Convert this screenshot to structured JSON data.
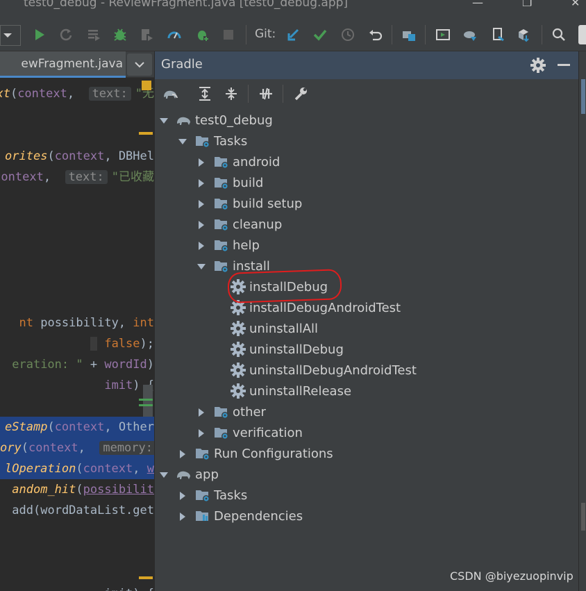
{
  "window": {
    "title": "test0_debug - ReviewFragment.java [test0_debug.app]",
    "minimize": "—",
    "maximize": "❐",
    "close": "✕"
  },
  "toolbar": {
    "git_label": "Git:",
    "icons": [
      "config-dropdown",
      "run-icon",
      "rerun-icon",
      "run-coverage-icon",
      "debug-icon",
      "profile-icon",
      "profiler-icon",
      "attach-debugger-icon",
      "stop-icon",
      "git-update-icon",
      "git-commit-icon",
      "git-history-icon",
      "git-rollback-icon",
      "project-structure-icon",
      "emulator-icon",
      "gradle-sync-icon",
      "device-manager-icon",
      "sdk-manager-icon",
      "search-icon"
    ]
  },
  "editor": {
    "tab_label": "ewFragment.java",
    "lines": [
      {
        "segments": [
          [
            "fni",
            "ext"
          ],
          [
            "plain",
            "("
          ],
          [
            "pr",
            "context"
          ],
          [
            "plain",
            ",  "
          ],
          [
            "hint",
            "text:"
          ],
          [
            "str",
            "\"无"
          ]
        ]
      },
      {
        "segments": [
          [
            "fni",
            "orites"
          ],
          [
            "plain",
            "("
          ],
          [
            "pr",
            "context"
          ],
          [
            "plain",
            ", DBHel"
          ]
        ]
      },
      {
        "segments": [
          [
            "pr",
            "context"
          ],
          [
            "plain",
            ",  "
          ],
          [
            "hint",
            "text:"
          ],
          [
            "str",
            "\"已收藏"
          ]
        ]
      },
      {
        "segments": [
          [
            "kw",
            "nt"
          ],
          [
            "plain",
            " possibility, "
          ],
          [
            "kw",
            "int"
          ]
        ]
      },
      {
        "segments": [
          [
            "hl",
            " "
          ],
          [
            "kw",
            " false"
          ],
          [
            "plain",
            ");"
          ]
        ]
      },
      {
        "segments": [
          [
            "str",
            "eration: \""
          ],
          [
            "plain",
            " + "
          ],
          [
            "pr",
            "wordId"
          ],
          [
            "plain",
            ")"
          ]
        ]
      },
      {
        "segments": [
          [
            "pr",
            "imit"
          ],
          [
            "plain",
            ") {"
          ]
        ]
      },
      {
        "segments": [
          [
            "fni",
            "eStamp"
          ],
          [
            "plain",
            "("
          ],
          [
            "pr",
            "context"
          ],
          [
            "plain",
            ", Other"
          ]
        ]
      },
      {
        "segments": [
          [
            "fni",
            "ory"
          ],
          [
            "plain",
            "("
          ],
          [
            "pr",
            "context"
          ],
          [
            "plain",
            ",  "
          ],
          [
            "hint",
            "memory:"
          ]
        ]
      },
      {
        "segments": [
          [
            "fni",
            "lOperation"
          ],
          [
            "plain",
            "("
          ],
          [
            "pr",
            "context"
          ],
          [
            "plain",
            ", "
          ],
          [
            "ulp",
            "w"
          ]
        ]
      },
      {
        "segments": [
          [
            "fni",
            "andom_hit"
          ],
          [
            "plain",
            "("
          ],
          [
            "ulp",
            "possibilit"
          ]
        ]
      },
      {
        "segments": [
          [
            "plain",
            "add(wordDataList.get"
          ]
        ]
      },
      {
        "segments": [
          [
            "plain",
            "       imit) {"
          ]
        ]
      }
    ]
  },
  "gradle": {
    "title": "Gradle",
    "tree": [
      {
        "label": "test0_debug",
        "level": 0,
        "expanded": true,
        "icon": "gradle-elephant-icon"
      },
      {
        "label": "Tasks",
        "level": 1,
        "expanded": true,
        "icon": "task-folder-icon"
      },
      {
        "label": "android",
        "level": 2,
        "expanded": false,
        "icon": "task-folder-icon"
      },
      {
        "label": "build",
        "level": 2,
        "expanded": false,
        "icon": "task-folder-icon"
      },
      {
        "label": "build setup",
        "level": 2,
        "expanded": false,
        "icon": "task-folder-icon"
      },
      {
        "label": "cleanup",
        "level": 2,
        "expanded": false,
        "icon": "task-folder-icon"
      },
      {
        "label": "help",
        "level": 2,
        "expanded": false,
        "icon": "task-folder-icon"
      },
      {
        "label": "install",
        "level": 2,
        "expanded": true,
        "icon": "task-folder-icon"
      },
      {
        "label": "installDebug",
        "level": 3,
        "leaf": true,
        "icon": "gear-icon"
      },
      {
        "label": "installDebugAndroidTest",
        "level": 3,
        "leaf": true,
        "icon": "gear-icon"
      },
      {
        "label": "uninstallAll",
        "level": 3,
        "leaf": true,
        "icon": "gear-icon"
      },
      {
        "label": "uninstallDebug",
        "level": 3,
        "leaf": true,
        "icon": "gear-icon"
      },
      {
        "label": "uninstallDebugAndroidTest",
        "level": 3,
        "leaf": true,
        "icon": "gear-icon"
      },
      {
        "label": "uninstallRelease",
        "level": 3,
        "leaf": true,
        "icon": "gear-icon"
      },
      {
        "label": "other",
        "level": 2,
        "expanded": false,
        "icon": "task-folder-icon"
      },
      {
        "label": "verification",
        "level": 2,
        "expanded": false,
        "icon": "task-folder-icon"
      },
      {
        "label": "Run Configurations",
        "level": 1,
        "expanded": false,
        "icon": "task-folder-icon"
      },
      {
        "label": "app",
        "level": 0,
        "expanded": true,
        "icon": "gradle-elephant-icon"
      },
      {
        "label": "Tasks",
        "level": 1,
        "expanded": false,
        "icon": "task-folder-icon"
      },
      {
        "label": "Dependencies",
        "level": 1,
        "expanded": false,
        "icon": "dependencies-icon"
      }
    ]
  },
  "watermark": "CSDN @biyezuopinvip",
  "colors": {
    "accent_blue": "#4a88c7",
    "run_green": "#499c54",
    "folder_blue": "#6e9ec6",
    "annotation_red": "#e11d1d"
  }
}
